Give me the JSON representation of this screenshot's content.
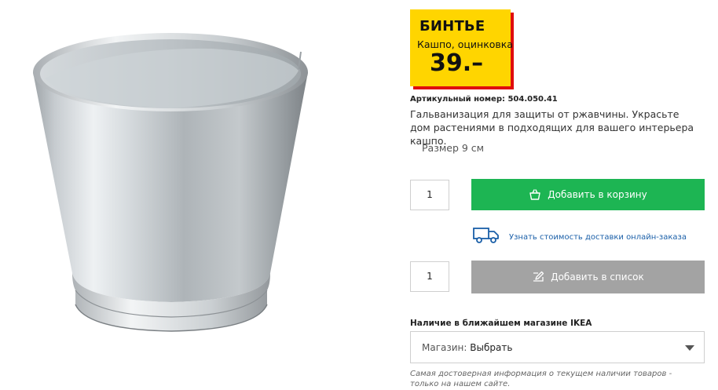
{
  "product": {
    "image_alt": "Оцинкованное кашпо",
    "name": "БИНТЬЕ",
    "subtitle": "Кашпо, оцинковка",
    "price": "39.–",
    "article": "Артикульный номер: 504.050.41",
    "description": "Гальванизация для защиты от ржавчины. Украсьте дом растениями в подходящих для вашего интерьера кашпо.",
    "size": "Размер 9 см"
  },
  "cart": {
    "quantity": "1",
    "add_label": "Добавить в корзину",
    "icon": "shopping-bag-icon",
    "color": "#1db553"
  },
  "delivery": {
    "icon": "truck-icon",
    "link_label": "Узнать стоимость доставки онлайн-заказа"
  },
  "list": {
    "quantity": "1",
    "add_label": "Добавить в список",
    "icon": "pencil-list-icon",
    "color": "#a3a3a3"
  },
  "store": {
    "heading": "Наличие в ближайшем магазине IKEA",
    "select_label": "Магазин:",
    "select_value": "Выбрать",
    "note": "Самая достоверная информация о текущем наличии товаров - только на нашем сайте."
  },
  "colors": {
    "price_tag_bg": "#ffd500",
    "price_tag_shadow": "#e00d0d",
    "link": "#1a5fa8"
  }
}
